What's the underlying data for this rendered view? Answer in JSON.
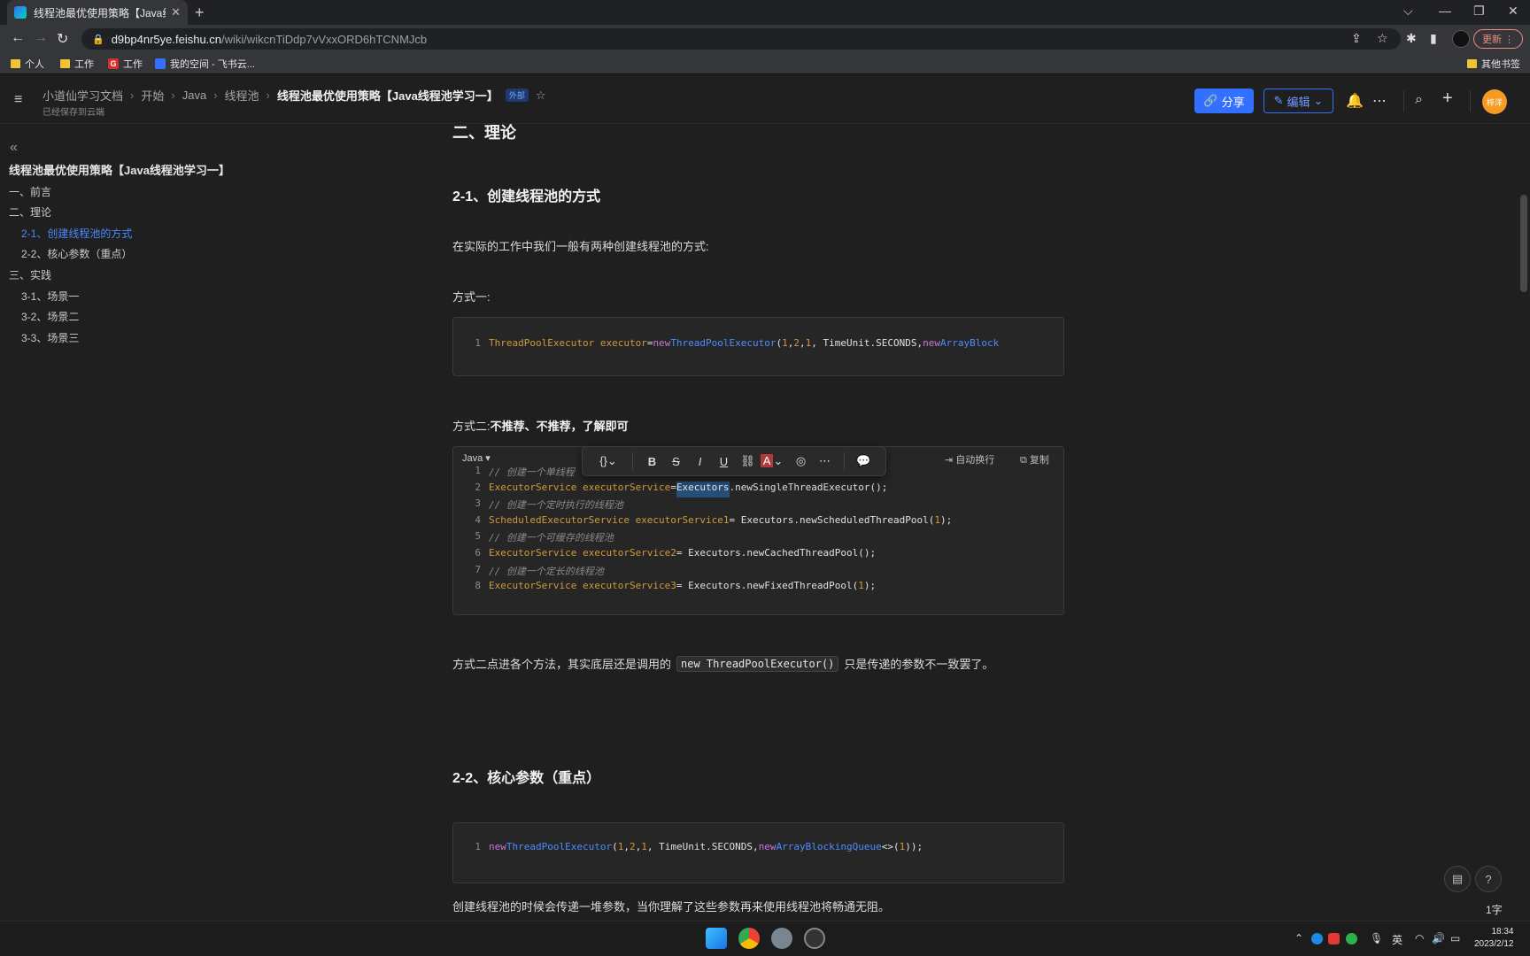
{
  "browser": {
    "tab_title": "线程池最优使用策略【Java线程池",
    "url_host": "d9bp4nr5ye.feishu.cn",
    "url_path": "/wiki/wikcnTiDdp7vVxxORD6hTCNMJcb",
    "update_label": "更新",
    "bookmarks": [
      "个人",
      "工作",
      "工作",
      "我的空间 - 飞书云..."
    ],
    "other_bookmarks": "其他书签"
  },
  "header": {
    "breadcrumbs": [
      "小道仙学习文档",
      "开始",
      "Java",
      "线程池"
    ],
    "current": "线程池最优使用策略【Java线程池学习一】",
    "external_badge": "外部",
    "saved_status": "已经保存到云端",
    "share_label": "分享",
    "edit_label": "编辑",
    "avatar_text": "梓洋"
  },
  "toc": {
    "title": "线程池最优使用策略【Java线程池学习一】",
    "items": [
      {
        "label": "一、前言"
      },
      {
        "label": "二、理论"
      },
      {
        "label": "2-1、创建线程池的方式"
      },
      {
        "label": "2-2、核心参数（重点）"
      },
      {
        "label": "三、实践"
      },
      {
        "label": "3-1、场景一"
      },
      {
        "label": "3-2、场景二"
      },
      {
        "label": "3-3、场景三"
      }
    ],
    "active_index": 2
  },
  "doc": {
    "h_theory": "二、理论",
    "h_create": "2-1、创建线程池的方式",
    "p_intro": "在实际的工作中我们一般有两种创建线程池的方式:",
    "p_way1": "方式一:",
    "p_way2_prefix": "方式二:",
    "p_way2_bold": "不推荐、不推荐，了解即可",
    "code_lang": "Java",
    "wrap_label": "自动换行",
    "copy_label": "复制",
    "p_explain_a": "方式二点进各个方法，其实底层还是调用的",
    "p_explain_code": "new ThreadPoolExecutor()",
    "p_explain_b": "只是传递的参数不一致罢了。",
    "h_core": "2-2、核心参数（重点）",
    "p_core": "创建线程池的时候会传递一堆参数，当你理解了这些参数再来使用线程池将畅通无阻。"
  },
  "code1": [
    {
      "n": "1",
      "tokens": [
        {
          "c": "id",
          "t": "ThreadPoolExecutor executor"
        },
        {
          "c": "pl",
          "t": " = "
        },
        {
          "c": "kw",
          "t": "new "
        },
        {
          "c": "ty",
          "t": "ThreadPoolExecutor"
        },
        {
          "c": "pl",
          "t": "("
        },
        {
          "c": "nm",
          "t": "1"
        },
        {
          "c": "pl",
          "t": ","
        },
        {
          "c": "nm",
          "t": "2"
        },
        {
          "c": "pl",
          "t": ", "
        },
        {
          "c": "nm",
          "t": "1"
        },
        {
          "c": "pl",
          "t": ", TimeUnit.SECONDS, "
        },
        {
          "c": "kw",
          "t": "new "
        },
        {
          "c": "ty",
          "t": "ArrayBlock"
        }
      ]
    }
  ],
  "code2": [
    {
      "n": "1",
      "tokens": [
        {
          "c": "cm",
          "t": "// 创建一个单线程"
        }
      ]
    },
    {
      "n": "2",
      "tokens": [
        {
          "c": "id",
          "t": "ExecutorService executorService"
        },
        {
          "c": "pl",
          "t": " = "
        },
        {
          "c": "sel",
          "t": "Executors"
        },
        {
          "c": "pl",
          "t": ".newSingleThreadExecutor();"
        }
      ]
    },
    {
      "n": "3",
      "tokens": [
        {
          "c": "cm",
          "t": "// 创建一个定时执行的线程池"
        }
      ]
    },
    {
      "n": "4",
      "tokens": [
        {
          "c": "id",
          "t": "ScheduledExecutorService executorService1"
        },
        {
          "c": "pl",
          "t": " = Executors.newScheduledThreadPool("
        },
        {
          "c": "nm",
          "t": "1"
        },
        {
          "c": "pl",
          "t": ");"
        }
      ]
    },
    {
      "n": "5",
      "tokens": [
        {
          "c": "cm",
          "t": "// 创建一个可缓存的线程池"
        }
      ]
    },
    {
      "n": "6",
      "tokens": [
        {
          "c": "id",
          "t": "ExecutorService executorService2"
        },
        {
          "c": "pl",
          "t": " = Executors.newCachedThreadPool();"
        }
      ]
    },
    {
      "n": "7",
      "tokens": [
        {
          "c": "cm",
          "t": "// 创建一个定长的线程池"
        }
      ]
    },
    {
      "n": "8",
      "tokens": [
        {
          "c": "id",
          "t": "ExecutorService executorService3"
        },
        {
          "c": "pl",
          "t": " = Executors.newFixedThreadPool("
        },
        {
          "c": "nm",
          "t": "1"
        },
        {
          "c": "pl",
          "t": ");"
        }
      ]
    }
  ],
  "code3": [
    {
      "n": "1",
      "tokens": [
        {
          "c": "kw",
          "t": "new "
        },
        {
          "c": "ty",
          "t": "ThreadPoolExecutor"
        },
        {
          "c": "pl",
          "t": "("
        },
        {
          "c": "nm",
          "t": "1"
        },
        {
          "c": "pl",
          "t": ","
        },
        {
          "c": "nm",
          "t": "2"
        },
        {
          "c": "pl",
          "t": ", "
        },
        {
          "c": "nm",
          "t": "1"
        },
        {
          "c": "pl",
          "t": ", TimeUnit.SECONDS, "
        },
        {
          "c": "kw",
          "t": "new "
        },
        {
          "c": "ty",
          "t": "ArrayBlockingQueue"
        },
        {
          "c": "pl",
          "t": "<>("
        },
        {
          "c": "nm",
          "t": "1"
        },
        {
          "c": "pl",
          "t": "));"
        }
      ]
    }
  ],
  "status": {
    "word_count": "1字",
    "time": "18:34",
    "date": "2023/2/12",
    "ime": "英"
  },
  "colors": {
    "accent": "#3370ff",
    "avatar": "#f59a23",
    "keyword": "#c678dd",
    "type": "#4c8dff",
    "identifier": "#d19a3a"
  }
}
